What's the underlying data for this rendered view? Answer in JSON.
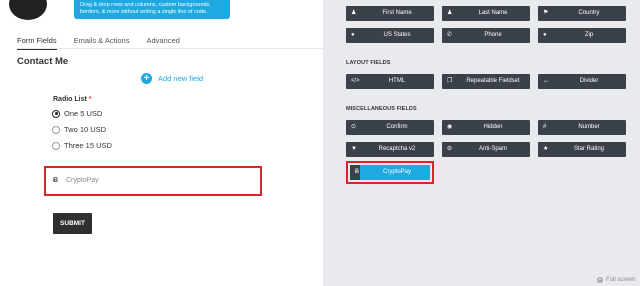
{
  "banner": {
    "text": "Drag & drop rows and columns, custom backgrounds, borders, & more without writing a single line of code."
  },
  "tabs": [
    {
      "label": "Form Fields"
    },
    {
      "label": "Emails & Actions"
    },
    {
      "label": "Advanced"
    }
  ],
  "form": {
    "title": "Contact Me",
    "add_field_label": "Add new field",
    "radio_label": "Radio List",
    "radio_required": "*",
    "radio_options": [
      {
        "label": "One 5 USD",
        "selected": true
      },
      {
        "label": "Two 10 USD",
        "selected": false
      },
      {
        "label": "Three 15 USD",
        "selected": false
      }
    ],
    "crypto_symbol": "Ƀ",
    "crypto_placeholder": "CryptoPay",
    "submit_label": "SUBMIT"
  },
  "user_info_fields": [
    {
      "label": "First Name",
      "icon": "user-icon",
      "glyph": "♟"
    },
    {
      "label": "Last Name",
      "icon": "user-icon",
      "glyph": "♟"
    },
    {
      "label": "Country",
      "icon": "flag-icon",
      "glyph": "⚑"
    },
    {
      "label": "US States",
      "icon": "map-marker-icon",
      "glyph": "●"
    },
    {
      "label": "Phone",
      "icon": "phone-icon",
      "glyph": "✆"
    },
    {
      "label": "Zip",
      "icon": "map-marker-icon",
      "glyph": "●"
    }
  ],
  "layout_fields": {
    "heading": "LAYOUT FIELDS",
    "items": [
      {
        "label": "HTML",
        "icon": "code-icon",
        "glyph": "</>"
      },
      {
        "label": "Repeatable Fieldset",
        "icon": "copy-icon",
        "glyph": "❐"
      },
      {
        "label": "Divider",
        "icon": "arrows-h-icon",
        "glyph": "↔"
      }
    ]
  },
  "misc_fields": {
    "heading": "MISCELLANEOUS FIELDS",
    "items": [
      {
        "label": "Confirm",
        "icon": "check-circle-icon",
        "glyph": "⊙"
      },
      {
        "label": "Hidden",
        "icon": "eye-slash-icon",
        "glyph": "◉"
      },
      {
        "label": "Number",
        "icon": "hashtag-icon",
        "glyph": "#"
      },
      {
        "label": "Recaptcha v2",
        "icon": "filter-icon",
        "glyph": "▼"
      },
      {
        "label": "Anti-Spam",
        "icon": "ban-icon",
        "glyph": "⊘"
      },
      {
        "label": "Star Rating",
        "icon": "star-icon",
        "glyph": "★"
      },
      {
        "label": "CryptoPay",
        "icon": "bitcoin-icon",
        "glyph": "Ƀ"
      }
    ]
  },
  "footer": {
    "fullscreen_label": "Full screen"
  },
  "colors": {
    "accent": "#1ea9e1",
    "dark_button": "#3b4148",
    "highlight": "#d9262b"
  }
}
